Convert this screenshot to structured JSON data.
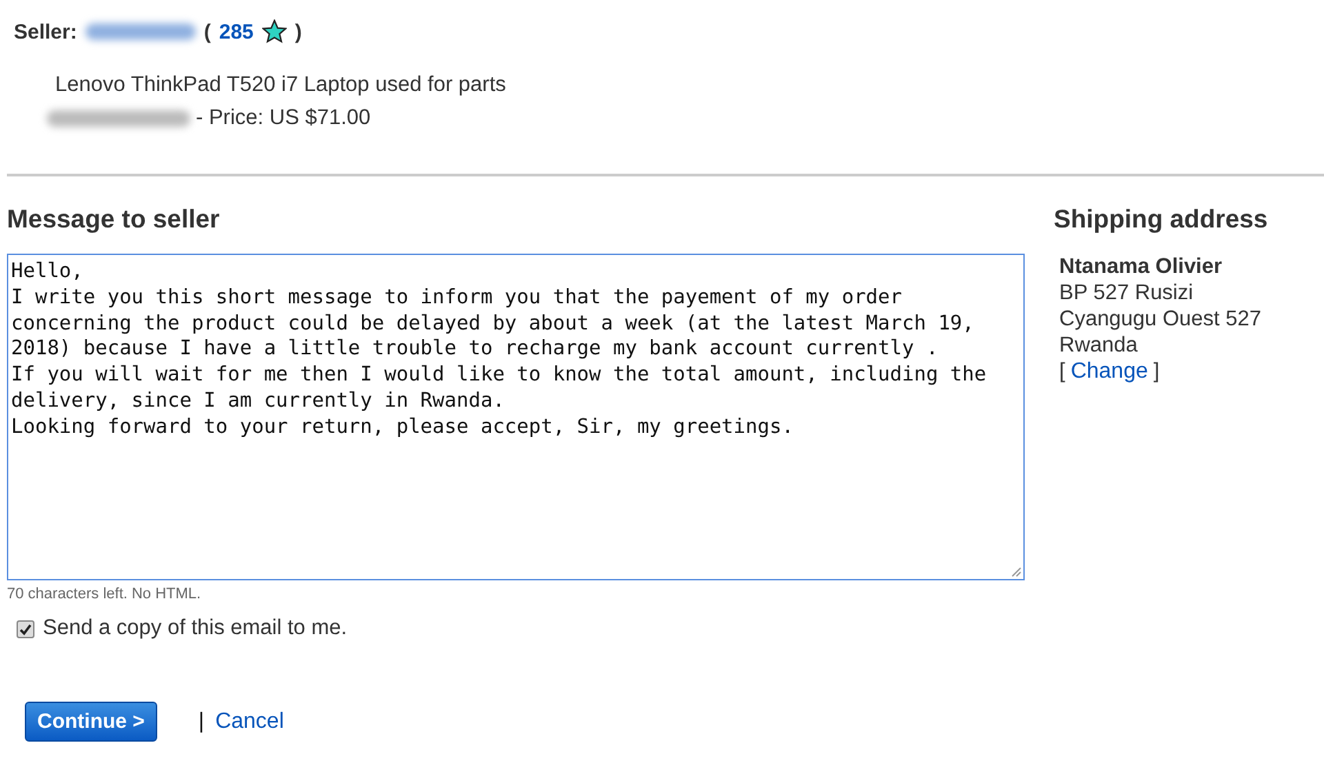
{
  "seller": {
    "label": "Seller:",
    "open_paren": "(",
    "feedback_score": "285",
    "close_paren": ")"
  },
  "item": {
    "title": "Lenovo ThinkPad T520 i7 Laptop used for parts",
    "price": "- Price: US $71.00"
  },
  "message": {
    "heading": "Message to seller",
    "lines": [
      "Hello,",
      "I write you this short message to inform you that the payement of my order",
      "concerning the product could be delayed by about a week (at the latest March 19,",
      "2018) because I have a little trouble to recharge my bank account currently .",
      "If you will wait for me then I would like to know the total amount, including the",
      "delivery, since I am currently in Rwanda.",
      "Looking forward to your return, please accept, Sir, my greetings."
    ],
    "hint": "70 characters left. No HTML."
  },
  "copy_option": {
    "label": "Send a copy of this email to me.",
    "checked": true
  },
  "actions": {
    "continue": "Continue >",
    "separator": "|",
    "cancel": "Cancel"
  },
  "shipping": {
    "heading": "Shipping address",
    "name": "Ntanama Olivier",
    "address": [
      "BP 527 Rusizi",
      "Cyangugu Ouest 527",
      "Rwanda"
    ],
    "open_bracket": "[",
    "change": "Change",
    "close_bracket": "]"
  }
}
